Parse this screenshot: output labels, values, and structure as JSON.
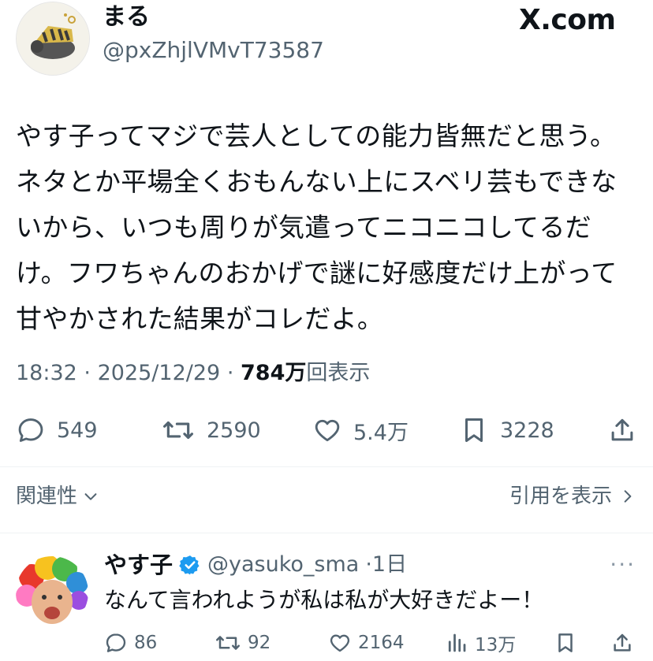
{
  "author": {
    "display_name": "まる",
    "handle": "@pxZhjlVMvT73587",
    "avatar_icon": "cat-sleeping-avatar"
  },
  "watermark": "X.com",
  "tweet": {
    "text": "やす子ってマジで芸人としての能力皆無だと思う。\nネタとか平場全くおもんない上にスベリ芸もできな\nいから、いつも周りが気遣ってニコニコしてるだ\nけ。フワちゃんのおかげで謎に好感度だけ上がって\n甘やかされた結果がコレだよ。",
    "time": "18:32",
    "separator": "·",
    "date": "2025/12/29",
    "views_count": "784",
    "views_unit": "万",
    "views_label": "回表示"
  },
  "actions": {
    "replies": "549",
    "reposts": "2590",
    "likes": "5.4万",
    "bookmarks": "3228"
  },
  "related": {
    "label": "関連性",
    "quotes_label": "引用を表示"
  },
  "reply": {
    "display_name": "やす子",
    "handle": "@yasuko_sma",
    "age": "·1日",
    "text": "なんて言われようが私は私が大好きだよー！",
    "replies": "86",
    "reposts": "92",
    "likes": "2164",
    "views": "13万",
    "more_label": "···"
  },
  "colors": {
    "text": "#0f1419",
    "secondary": "#536471",
    "verified": "#1d9bf0"
  }
}
